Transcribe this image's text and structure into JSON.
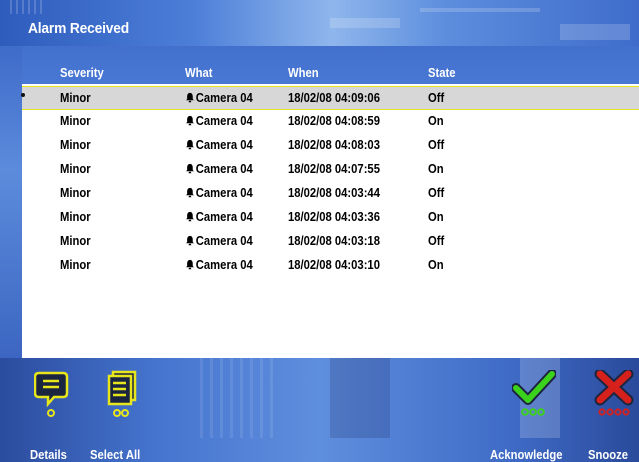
{
  "window": {
    "title": "Alarm Received"
  },
  "columns": {
    "severity": "Severity",
    "what": "What",
    "when": "When",
    "state": "State"
  },
  "alarms": [
    {
      "severity": "Minor",
      "what": "Camera 04",
      "when": "18/02/08 04:09:06",
      "state": "Off",
      "selected": true
    },
    {
      "severity": "Minor",
      "what": "Camera 04",
      "when": "18/02/08 04:08:59",
      "state": "On"
    },
    {
      "severity": "Minor",
      "what": "Camera 04",
      "when": "18/02/08 04:08:03",
      "state": "Off"
    },
    {
      "severity": "Minor",
      "what": "Camera 04",
      "when": "18/02/08 04:07:55",
      "state": "On"
    },
    {
      "severity": "Minor",
      "what": "Camera 04",
      "when": "18/02/08 04:03:44",
      "state": "Off"
    },
    {
      "severity": "Minor",
      "what": "Camera 04",
      "when": "18/02/08 04:03:36",
      "state": "On"
    },
    {
      "severity": "Minor",
      "what": "Camera 04",
      "when": "18/02/08 04:03:18",
      "state": "Off"
    },
    {
      "severity": "Minor",
      "what": "Camera 04",
      "when": "18/02/08 04:03:10",
      "state": "On"
    }
  ],
  "toolbar": {
    "details": {
      "label": "Details",
      "icon": "speech-bubble-icon",
      "color": "#e7e51b"
    },
    "select_all": {
      "label": "Select All",
      "icon": "documents-icon",
      "color": "#e7e51b"
    },
    "acknowledge": {
      "label": "Acknowledge",
      "icon": "check-icon",
      "color": "#3bd21c"
    },
    "snooze": {
      "label": "Snooze",
      "icon": "cross-icon",
      "color": "#d6201c"
    }
  },
  "colors": {
    "header_text": "#ffffff",
    "selected_row": "#d7d7d7",
    "selection_border": "#e7e51b"
  },
  "icons": {
    "what": "bell-icon"
  }
}
